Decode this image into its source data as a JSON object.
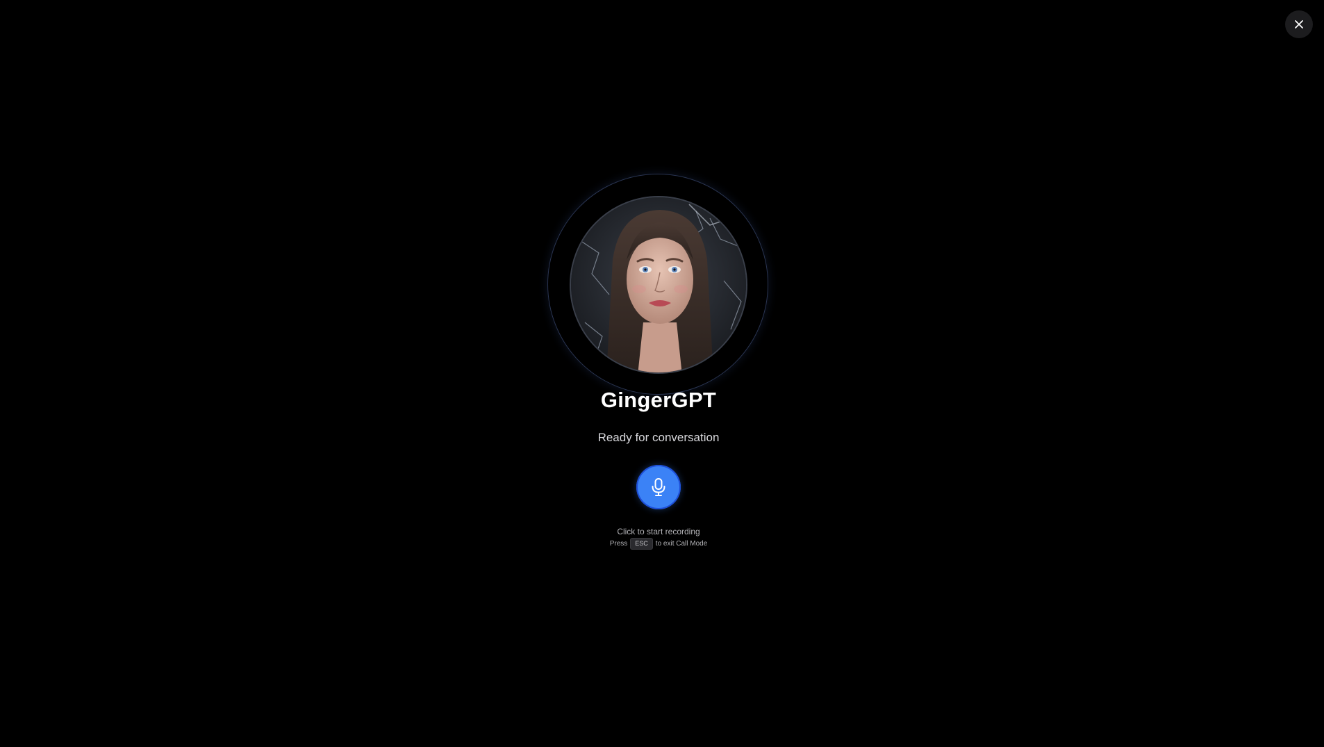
{
  "window": {
    "close_icon": "close-icon"
  },
  "call": {
    "assistant_name": "GingerGPT",
    "status": "Ready for conversation",
    "mic_icon": "microphone-icon",
    "mic_color": "#3b82f6",
    "hint": "Click to start recording",
    "esc_prefix": "Press",
    "esc_key": "ESC",
    "esc_suffix": "to exit Call Mode"
  }
}
